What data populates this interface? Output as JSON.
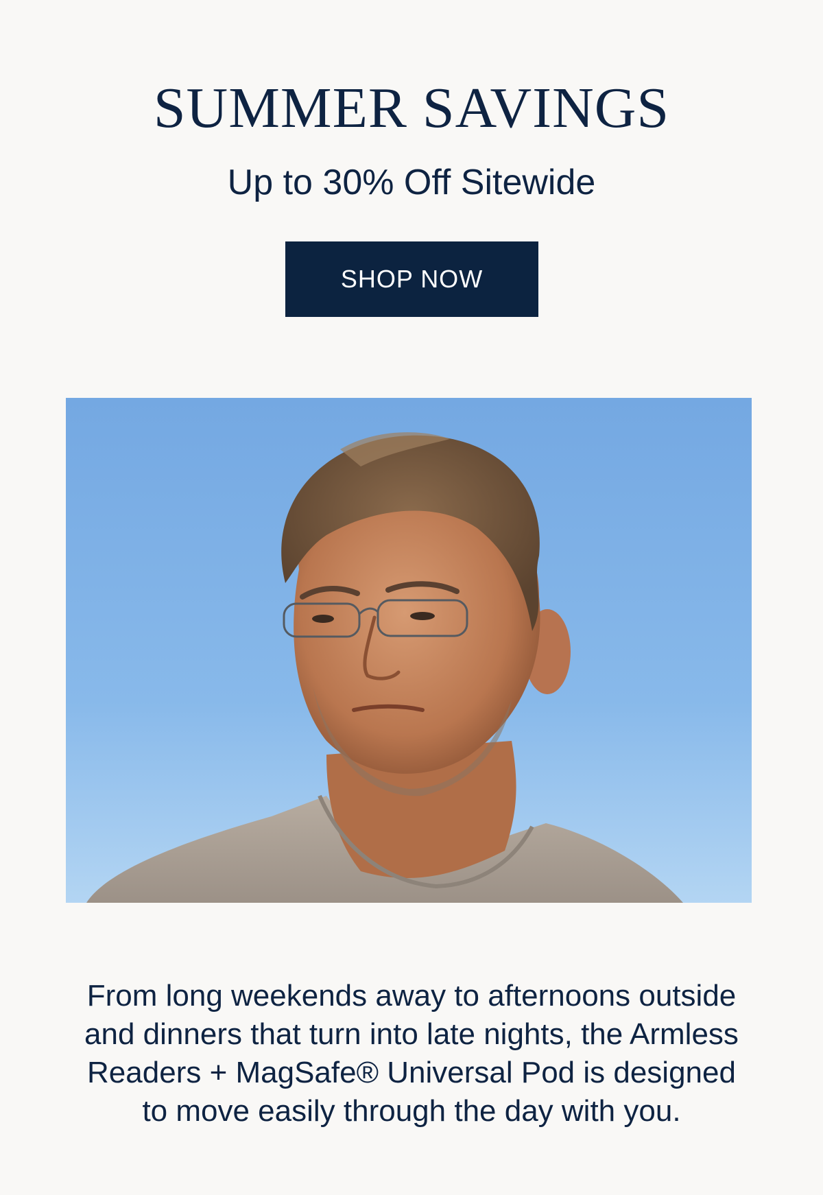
{
  "promo": {
    "headline": "SUMMER SAVINGS",
    "subheadline": "Up to 30% Off Sitewide",
    "cta_label": "SHOP NOW"
  },
  "hero": {
    "description": ""
  },
  "body": {
    "paragraph": "From long weekends away to afternoons outside and dinners that turn into late nights, the Armless Readers + MagSafe® Universal Pod is designed to move easily through the day with you."
  },
  "colors": {
    "background": "#f9f8f6",
    "brand_navy": "#0c2340",
    "sky_blue": "#86b7ea"
  }
}
